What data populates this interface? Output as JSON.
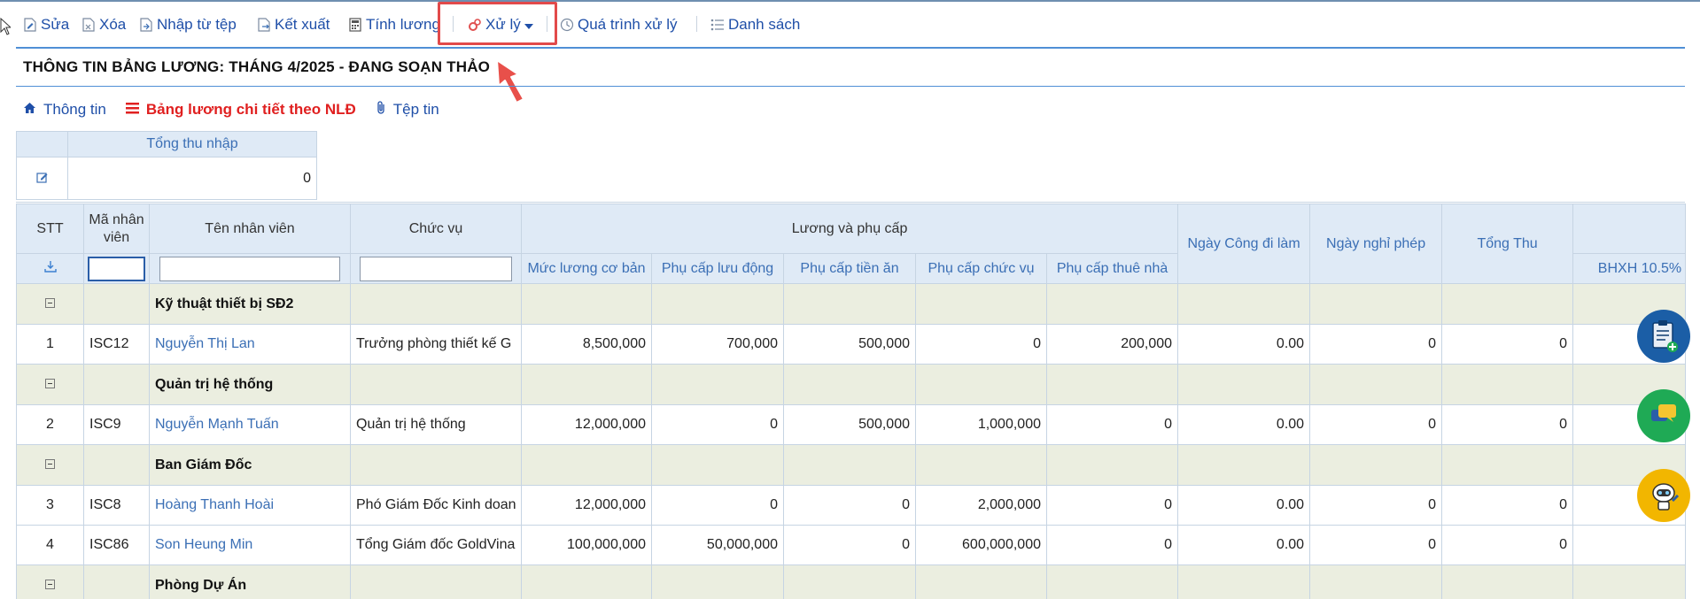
{
  "toolbar": {
    "items": [
      {
        "label": "Sửa",
        "icon": "edit-doc-icon"
      },
      {
        "label": "Xóa",
        "icon": "delete-doc-icon"
      },
      {
        "label": "Nhập từ tệp",
        "icon": "import-file-icon"
      },
      {
        "label": "Kết xuất",
        "icon": "export-icon"
      },
      {
        "label": "Tính lương",
        "icon": "calculator-icon"
      },
      {
        "label": "Xử lý",
        "icon": "gears-icon"
      },
      {
        "label": "Quá trình xử lý",
        "icon": "history-clock-icon"
      },
      {
        "label": "Danh sách",
        "icon": "list-icon"
      }
    ],
    "highlight_color": "#e24a4a"
  },
  "page_title": "THÔNG TIN BẢNG LƯƠNG: THÁNG 4/2025 - ĐANG SOẠN THẢO",
  "tabs": [
    {
      "label": "Thông tin",
      "icon": "home-icon",
      "active": false
    },
    {
      "label": "Bảng lương chi tiết theo NLĐ",
      "icon": "bars-icon",
      "active": true
    },
    {
      "label": "Tệp tin",
      "icon": "paperclip-icon",
      "active": false
    }
  ],
  "summary": {
    "header": "Tổng thu nhập",
    "value": "0"
  },
  "grid": {
    "headers": {
      "stt": "STT",
      "ma_nv": "Mã nhân viên",
      "ten_nv": "Tên nhân viên",
      "chuc_vu": "Chức vụ",
      "luong_group": "Lương và phụ cấp",
      "muc_luong": "Mức lương cơ bản",
      "pc_luu_dong": "Phụ cấp lưu động",
      "pc_tien_an": "Phụ cấp tiền ăn",
      "pc_chuc_vu": "Phụ cấp chức vụ",
      "pc_thue_nha": "Phụ cấp thuê nhà",
      "ngay_cong": "Ngày Công đi làm",
      "ngay_nghi": "Ngày nghỉ phép",
      "tong_thu": "Tổng Thu",
      "bhxh": "BHXH 10.5%"
    },
    "groups": [
      {
        "name": "Kỹ thuật thiết bị SĐ2",
        "rows": [
          {
            "stt": "1",
            "ma": "ISC12",
            "ten": "Nguyễn Thị Lan",
            "chuc_vu": "Trưởng phòng thiết kế G",
            "muc_luong": "8,500,000",
            "pc_luu_dong": "700,000",
            "pc_tien_an": "500,000",
            "pc_chuc_vu": "0",
            "pc_thue_nha": "200,000",
            "ngay_cong": "0.00",
            "ngay_nghi": "0",
            "tong_thu": "0"
          }
        ]
      },
      {
        "name": "Quản trị hệ thống",
        "rows": [
          {
            "stt": "2",
            "ma": "ISC9",
            "ten": "Nguyễn Mạnh Tuấn",
            "chuc_vu": "Quản trị hệ thống",
            "muc_luong": "12,000,000",
            "pc_luu_dong": "0",
            "pc_tien_an": "500,000",
            "pc_chuc_vu": "1,000,000",
            "pc_thue_nha": "0",
            "ngay_cong": "0.00",
            "ngay_nghi": "0",
            "tong_thu": "0"
          }
        ]
      },
      {
        "name": "Ban Giám Đốc",
        "rows": [
          {
            "stt": "3",
            "ma": "ISC8",
            "ten": "Hoàng Thanh Hoài",
            "chuc_vu": "Phó Giám Đốc Kinh doan",
            "muc_luong": "12,000,000",
            "pc_luu_dong": "0",
            "pc_tien_an": "0",
            "pc_chuc_vu": "2,000,000",
            "pc_thue_nha": "0",
            "ngay_cong": "0.00",
            "ngay_nghi": "0",
            "tong_thu": "0"
          },
          {
            "stt": "4",
            "ma": "ISC86",
            "ten": "Son Heung Min",
            "chuc_vu": "Tổng Giám đốc GoldVina",
            "muc_luong": "100,000,000",
            "pc_luu_dong": "50,000,000",
            "pc_tien_an": "0",
            "pc_chuc_vu": "600,000,000",
            "pc_thue_nha": "0",
            "ngay_cong": "0.00",
            "ngay_nghi": "0",
            "tong_thu": "0"
          }
        ]
      },
      {
        "name": "Phòng Dự Án",
        "rows": []
      }
    ]
  },
  "fabs": [
    {
      "icon": "add-document-icon",
      "color": "#1b5ea6"
    },
    {
      "icon": "chat-icon",
      "color": "#1faa55"
    },
    {
      "icon": "robot-support-icon",
      "color": "#f2b600"
    }
  ]
}
